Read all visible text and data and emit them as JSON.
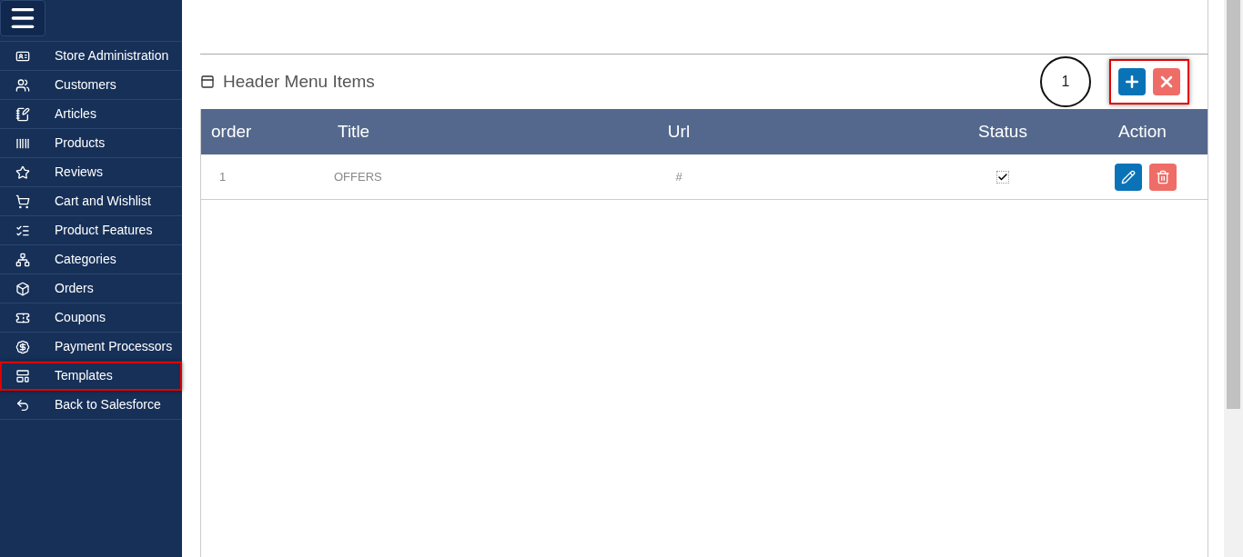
{
  "sidebar": {
    "items": [
      {
        "label": "Store Administration",
        "highlighted": false
      },
      {
        "label": "Customers",
        "highlighted": false
      },
      {
        "label": "Articles",
        "highlighted": false
      },
      {
        "label": "Products",
        "highlighted": false
      },
      {
        "label": "Reviews",
        "highlighted": false
      },
      {
        "label": "Cart and Wishlist",
        "highlighted": false
      },
      {
        "label": "Product Features",
        "highlighted": false
      },
      {
        "label": "Categories",
        "highlighted": false
      },
      {
        "label": "Orders",
        "highlighted": false
      },
      {
        "label": "Coupons",
        "highlighted": false
      },
      {
        "label": "Payment Processors",
        "highlighted": false
      },
      {
        "label": "Templates",
        "highlighted": true
      },
      {
        "label": "Back to Salesforce",
        "highlighted": false
      }
    ]
  },
  "section": {
    "title": "Header Menu Items",
    "callout": "1",
    "buttons_highlighted": true
  },
  "table": {
    "columns": [
      "order",
      "Title",
      "Url",
      "Status",
      "Action"
    ],
    "rows": [
      {
        "order": "1",
        "title": "OFFERS",
        "url": "#",
        "status": true
      }
    ]
  }
}
